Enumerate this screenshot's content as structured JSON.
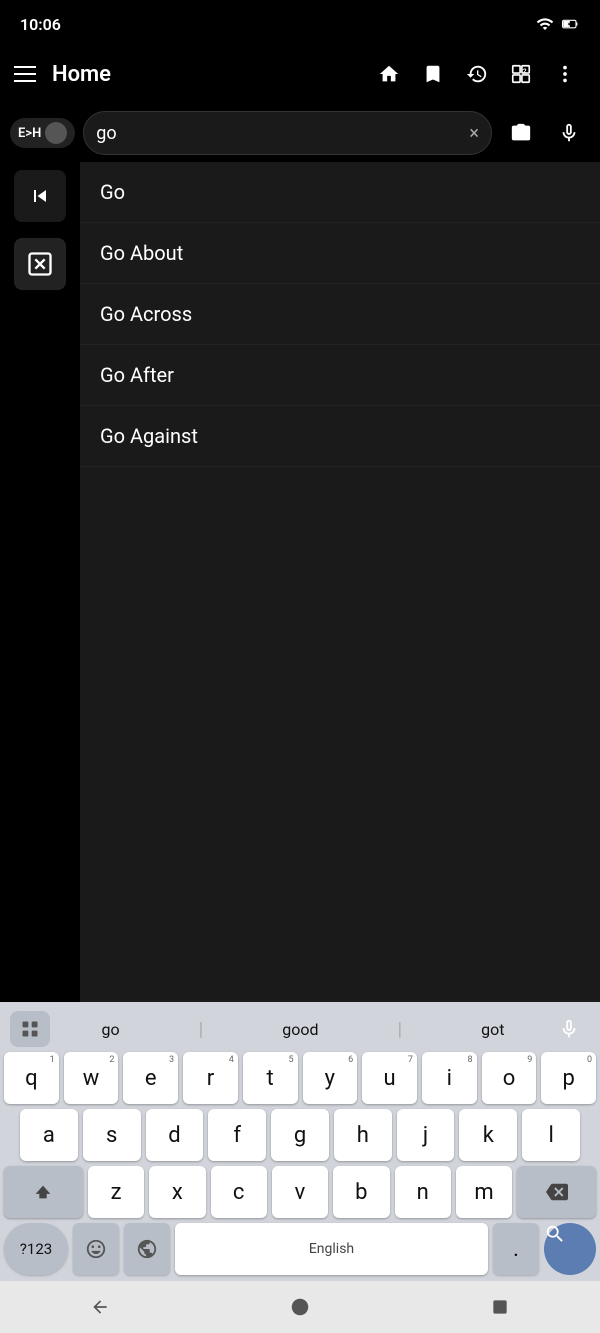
{
  "statusBar": {
    "time": "10:06"
  },
  "appBar": {
    "title": "Home",
    "icons": {
      "home": "🏠",
      "bookmark": "🔖",
      "history": "🕐",
      "layers": "⬜"
    }
  },
  "search": {
    "langLabel": "E>H",
    "inputValue": "go",
    "clearLabel": "×",
    "cameraLabel": "📷",
    "micLabel": "🎤"
  },
  "suggestions": [
    {
      "text": "Go"
    },
    {
      "text": "Go About"
    },
    {
      "text": "Go Across"
    },
    {
      "text": "Go After"
    },
    {
      "text": "Go Against"
    }
  ],
  "keyboard": {
    "suggestions": [
      "go",
      "good",
      "got"
    ],
    "rows": [
      [
        "q",
        "w",
        "e",
        "r",
        "t",
        "y",
        "u",
        "i",
        "o",
        "p"
      ],
      [
        "a",
        "s",
        "d",
        "f",
        "g",
        "h",
        "j",
        "k",
        "l"
      ],
      [
        "z",
        "x",
        "c",
        "v",
        "b",
        "n",
        "m"
      ]
    ],
    "nums": [
      "1",
      "2",
      "3",
      "4",
      "5",
      "6",
      "7",
      "8",
      "9",
      "0"
    ],
    "spacebar": "English",
    "numLabel": "?123",
    "periodLabel": ".",
    "searchLabel": "🔍"
  },
  "navBar": {
    "backLabel": "▼",
    "homeLabel": "●",
    "recentsLabel": "■"
  }
}
